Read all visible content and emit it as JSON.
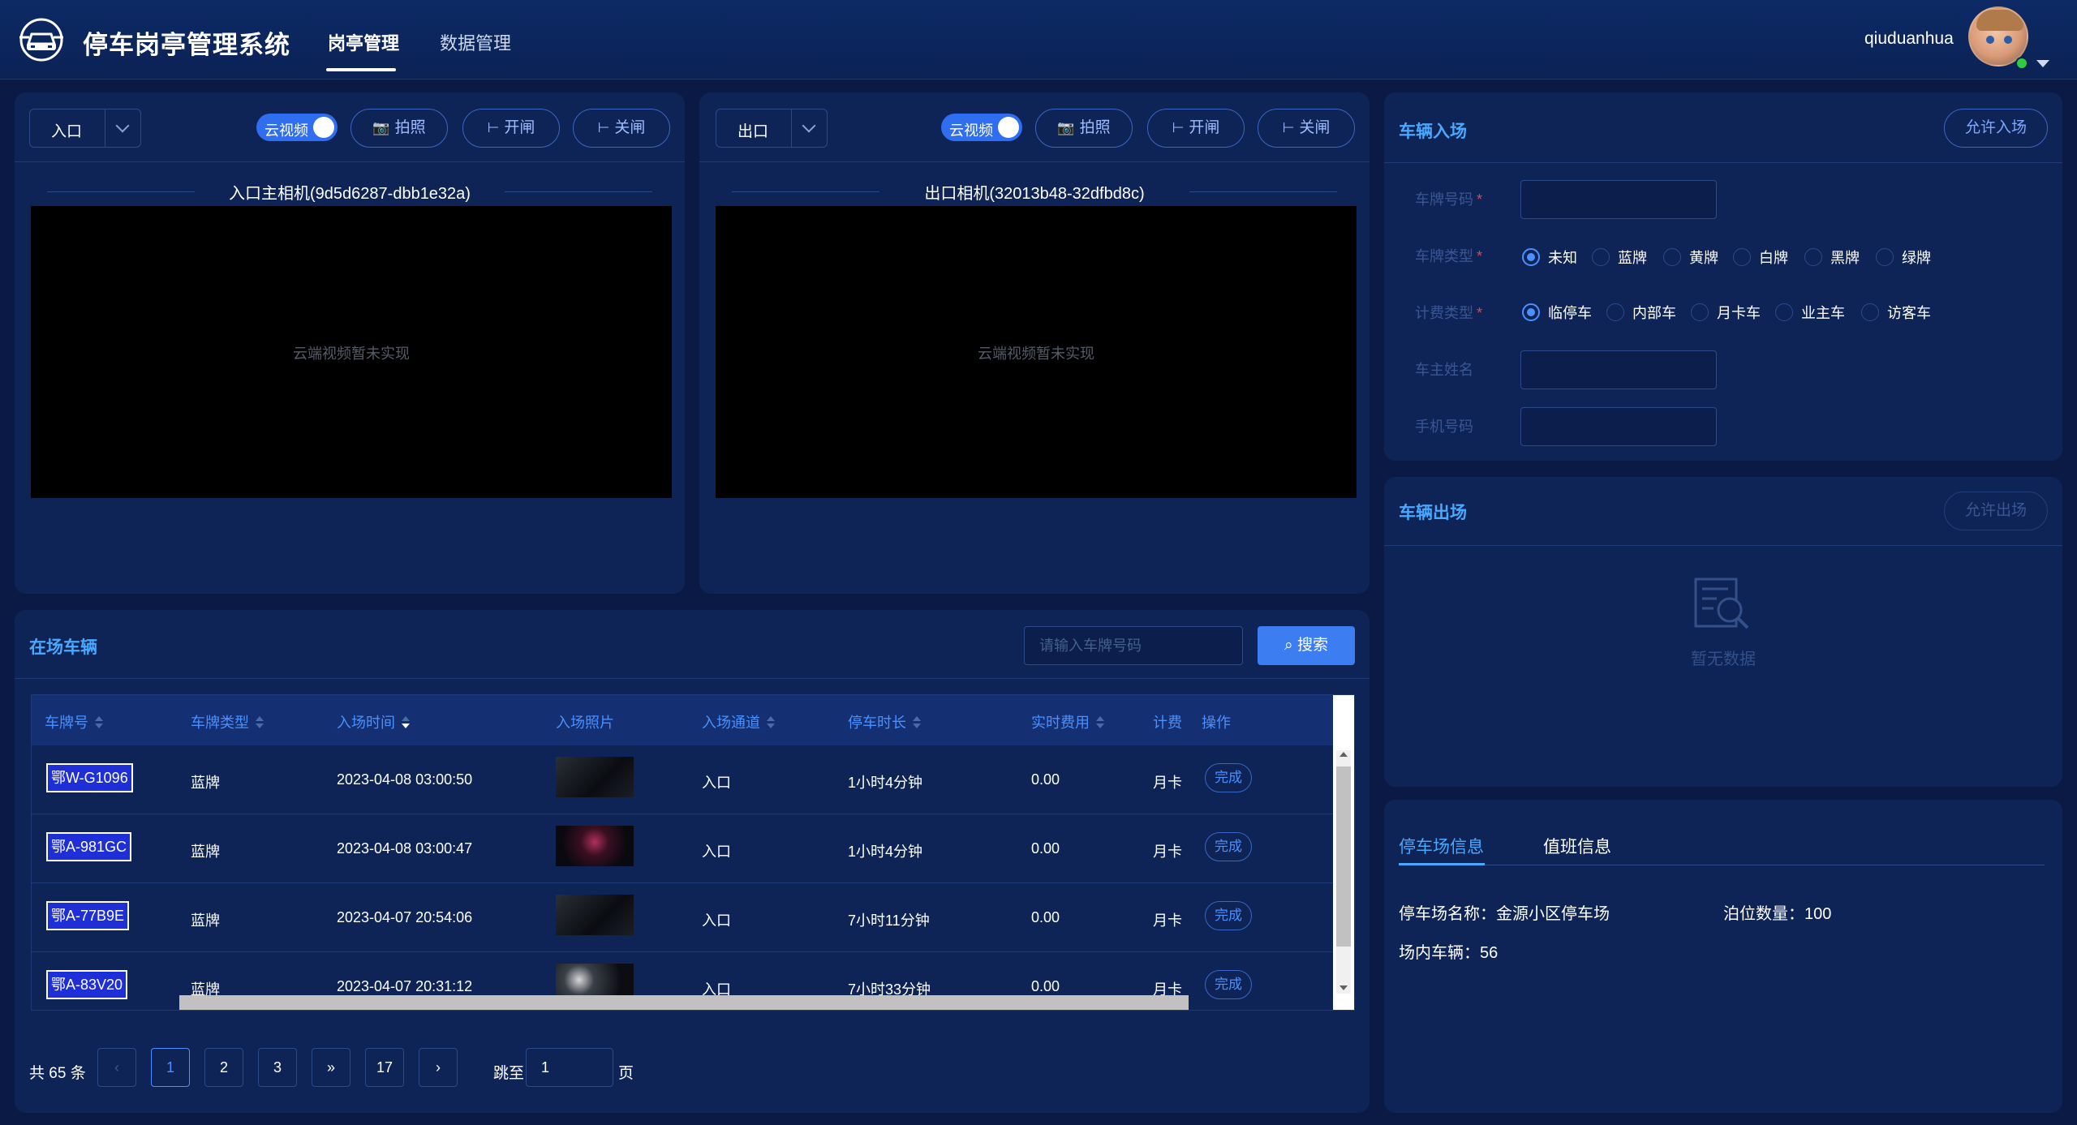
{
  "header": {
    "app_title": "停车岗亭管理系统",
    "tabs": [
      {
        "label": "岗亭管理",
        "active": true
      },
      {
        "label": "数据管理",
        "active": false
      }
    ],
    "username": "qiuduanhua"
  },
  "entry_camera": {
    "lane": "入口",
    "cloud_video_label": "云视频",
    "cloud_video_on": true,
    "buttons": {
      "snapshot": "拍照",
      "open_gate": "开闸",
      "close_gate": "关闸"
    },
    "camera_name": "入口主相机(9d5d6287-dbb1e32a)",
    "video_message": "云端视频暂未实现"
  },
  "exit_camera": {
    "lane": "出口",
    "cloud_video_label": "云视频",
    "cloud_video_on": true,
    "buttons": {
      "snapshot": "拍照",
      "open_gate": "开闸",
      "close_gate": "关闸"
    },
    "camera_name": "出口相机(32013b48-32dfbd8c)",
    "video_message": "云端视频暂未实现"
  },
  "vehicle_entry": {
    "title": "车辆入场",
    "allow_button": "允许入场",
    "fields": {
      "plate": "车牌号码",
      "plate_type": "车牌类型",
      "billing_type": "计费类型",
      "owner_name": "车主姓名",
      "phone": "手机号码"
    },
    "plate_types": [
      "未知",
      "蓝牌",
      "黄牌",
      "白牌",
      "黑牌",
      "绿牌"
    ],
    "plate_type_selected": "未知",
    "billing_types": [
      "临停车",
      "内部车",
      "月卡车",
      "业主车",
      "访客车"
    ],
    "billing_type_selected": "临停车"
  },
  "vehicle_exit": {
    "title": "车辆出场",
    "allow_button": "允许出场",
    "empty_text": "暂无数据"
  },
  "info": {
    "tabs": [
      "停车场信息",
      "值班信息"
    ],
    "active_tab": "停车场信息",
    "lot_name": "停车场名称：金源小区停车场",
    "spaces": "泊位数量：100",
    "vehicles_inside": "场内车辆：56"
  },
  "vehicles_in_lot": {
    "title": "在场车辆",
    "search_placeholder": "请输入车牌号码",
    "search_button": "搜索",
    "columns": [
      "车牌号",
      "车牌类型",
      "入场时间",
      "入场照片",
      "入场通道",
      "停车时长",
      "实时费用",
      "计费",
      "操作"
    ],
    "rows": [
      {
        "plate": "鄂W-G1096",
        "type": "蓝牌",
        "time": "2023-04-08 03:00:50",
        "lane": "入口",
        "duration": "1小时4分钟",
        "fee": "0.00",
        "billing": "月卡",
        "action": "完成"
      },
      {
        "plate": "鄂A-981GC",
        "type": "蓝牌",
        "time": "2023-04-08 03:00:47",
        "lane": "入口",
        "duration": "1小时4分钟",
        "fee": "0.00",
        "billing": "月卡",
        "action": "完成"
      },
      {
        "plate": "鄂A-77B9E",
        "type": "蓝牌",
        "time": "2023-04-07 20:54:06",
        "lane": "入口",
        "duration": "7小时11分钟",
        "fee": "0.00",
        "billing": "月卡",
        "action": "完成"
      },
      {
        "plate": "鄂A-83V20",
        "type": "蓝牌",
        "time": "2023-04-07 20:31:12",
        "lane": "入口",
        "duration": "7小时33分钟",
        "fee": "0.00",
        "billing": "月卡",
        "action": "完成"
      }
    ],
    "pagination": {
      "total": "共 65 条",
      "pages": [
        "1",
        "2",
        "3",
        "»",
        "17"
      ],
      "current": "1",
      "jump_label": "跳至",
      "jump_value": "1",
      "page_suffix": "页"
    }
  }
}
